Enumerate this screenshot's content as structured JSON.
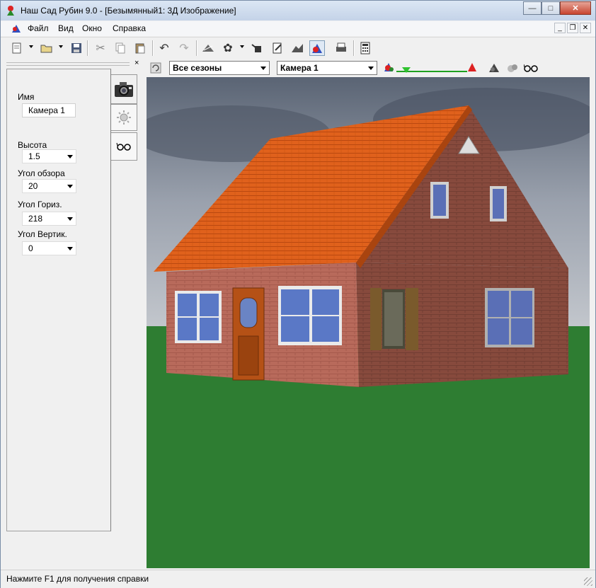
{
  "window": {
    "title": "Наш Сад Рубин 9.0 - [Безымянный1: 3Д Изображение]"
  },
  "menu": [
    "Файл",
    "Вид",
    "Окно",
    "Справка"
  ],
  "toolbar2": {
    "season": "Все сезоны",
    "camera": "Камера 1"
  },
  "panel": {
    "name_label": "Имя",
    "name_value": "Камера 1",
    "height_label": "Высота",
    "height_value": "1.5",
    "fov_label": "Угол обзора",
    "fov_value": "20",
    "hangle_label": "Угол Гориз.",
    "hangle_value": "218",
    "vangle_label": "Угол Вертик.",
    "vangle_value": "0"
  },
  "status": {
    "text": "Нажмите F1 для получения справки"
  },
  "colors": {
    "grass": "#2e7d32",
    "roof": "#e0611c",
    "brick": "#b56455",
    "sky": "#8d96a6"
  }
}
